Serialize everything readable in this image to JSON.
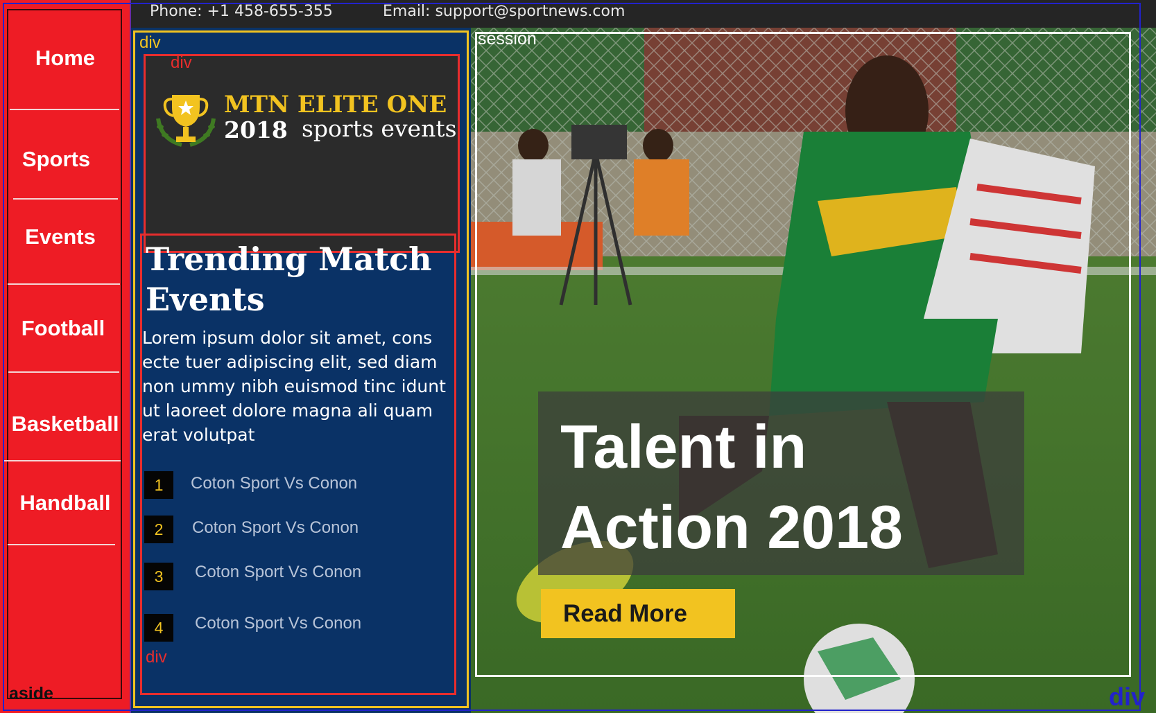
{
  "topbar": {
    "phone": "Phone: +1 458-655-355",
    "email": "Email: support@sportnews.com"
  },
  "aside": {
    "tag": "aside",
    "items": [
      {
        "label": "Home"
      },
      {
        "label": "Sports"
      },
      {
        "label": "Events"
      },
      {
        "label": "Football"
      },
      {
        "label": "Basketball"
      },
      {
        "label": "Handball"
      }
    ]
  },
  "middle": {
    "tag_outer": "div",
    "tag_logo": "div",
    "tag_trend": "div",
    "logo": {
      "line1": "MTN ELITE ONE",
      "year": "2018",
      "sub": "sports events",
      "icon": "trophy-icon"
    },
    "trending": {
      "title": "Trending Match Events",
      "text": "Lorem ipsum dolor sit amet, cons ecte tuer adipiscing elit, sed diam non ummy nibh euismod tinc idunt ut laoreet dolore magna ali quam erat volutpat",
      "matches": [
        {
          "num": "1",
          "label": "Coton Sport Vs  Conon"
        },
        {
          "num": "2",
          "label": "Coton Sport Vs  Conon"
        },
        {
          "num": "3",
          "label": "Coton Sport Vs  Conon"
        },
        {
          "num": "4",
          "label": "Coton Sport Vs  Conon"
        }
      ]
    }
  },
  "hero": {
    "session_tag": "session",
    "title": "Talent in Action 2018",
    "cta": "Read More",
    "div_tag": "div"
  },
  "colors": {
    "aside_bg": "#ee1c25",
    "middle_bg": "#0a3266",
    "accent_yellow": "#f2c320",
    "frame_red": "#e82d2d",
    "topbar_bg": "#252525"
  }
}
